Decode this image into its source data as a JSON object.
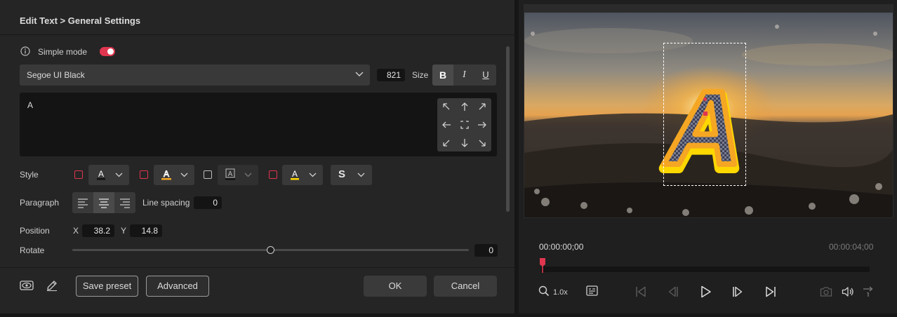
{
  "header": {
    "title": "Edit Text > General Settings"
  },
  "simple_mode": {
    "label": "Simple mode",
    "on": true
  },
  "font": {
    "name": "Segoe UI Black",
    "size": "821",
    "size_label": "Size",
    "bold": "B",
    "italic": "I",
    "underline": "U"
  },
  "text_area": {
    "value": "A"
  },
  "style": {
    "label": "Style",
    "shadow_symbol": "S"
  },
  "paragraph": {
    "label": "Paragraph",
    "line_spacing_label": "Line spacing",
    "line_spacing": "0"
  },
  "position": {
    "label": "Position",
    "x_label": "X",
    "x": "38.2",
    "y_label": "Y",
    "y": "14.8"
  },
  "rotate": {
    "label": "Rotate",
    "value": "0",
    "fraction": 0.5
  },
  "footer": {
    "save_preset": "Save preset",
    "advanced": "Advanced",
    "ok": "OK",
    "cancel": "Cancel"
  },
  "player": {
    "current_time": "00:00:00;00",
    "total_time": "00:00:04;00",
    "zoom": "1.0x",
    "preview_letter": "A"
  },
  "colors": {
    "accent": "#e0364f",
    "panel": "#252525",
    "field": "#141414",
    "outline_yellow": "#ffd700",
    "outline_orange": "#f5a623"
  }
}
